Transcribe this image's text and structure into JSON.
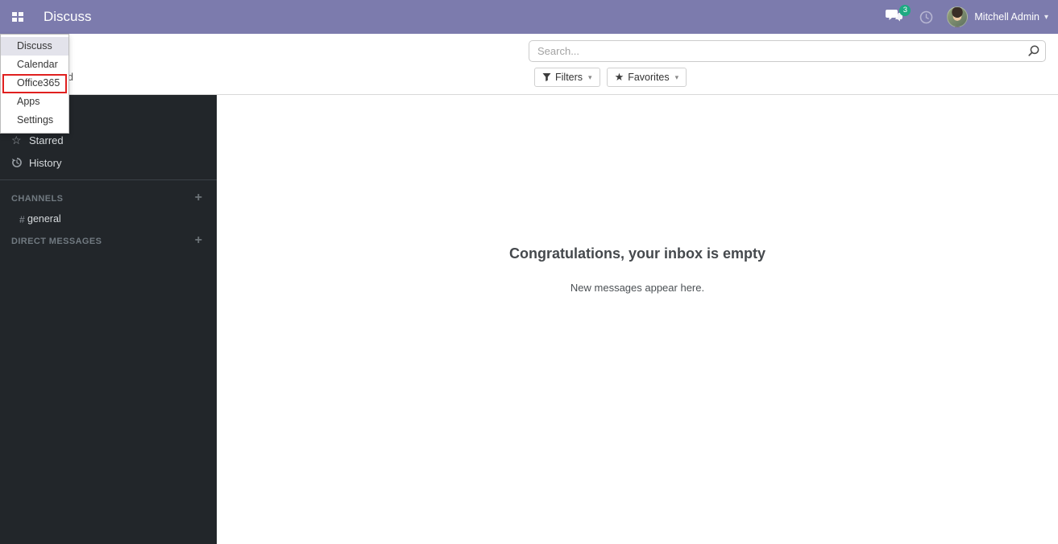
{
  "topbar": {
    "title": "Discuss",
    "messages_badge": "3",
    "user_name": "Mitchell Admin",
    "caret": "▾"
  },
  "apps_menu": {
    "items": [
      {
        "label": "Discuss"
      },
      {
        "label": "Calendar"
      },
      {
        "label": "Office365"
      },
      {
        "label": "Apps"
      },
      {
        "label": "Settings"
      }
    ],
    "highlighted_item": "Discuss",
    "annotated_item": "Office365"
  },
  "control_panel": {
    "obscured_text": "d",
    "search_placeholder": "Search...",
    "filters_label": "Filters",
    "favorites_label": "Favorites",
    "favorites_star": "★"
  },
  "sidebar": {
    "items": [
      {
        "label": "Starred",
        "icon": "star-icon",
        "glyph": "☆"
      },
      {
        "label": "History",
        "icon": "history-icon"
      }
    ],
    "sections": [
      {
        "title": "CHANNELS",
        "add_label": "+",
        "channels": [
          {
            "prefix": "#",
            "name": "general"
          }
        ]
      },
      {
        "title": "DIRECT MESSAGES",
        "add_label": "+",
        "channels": []
      }
    ]
  },
  "main": {
    "empty_title": "Congratulations, your inbox is empty",
    "empty_subtitle": "New messages appear here."
  },
  "colors": {
    "topbar_bg": "#7c7bad",
    "badge_bg": "#1eaa82",
    "sidebar_bg": "#22262a",
    "annotation_red": "#e0201f"
  }
}
